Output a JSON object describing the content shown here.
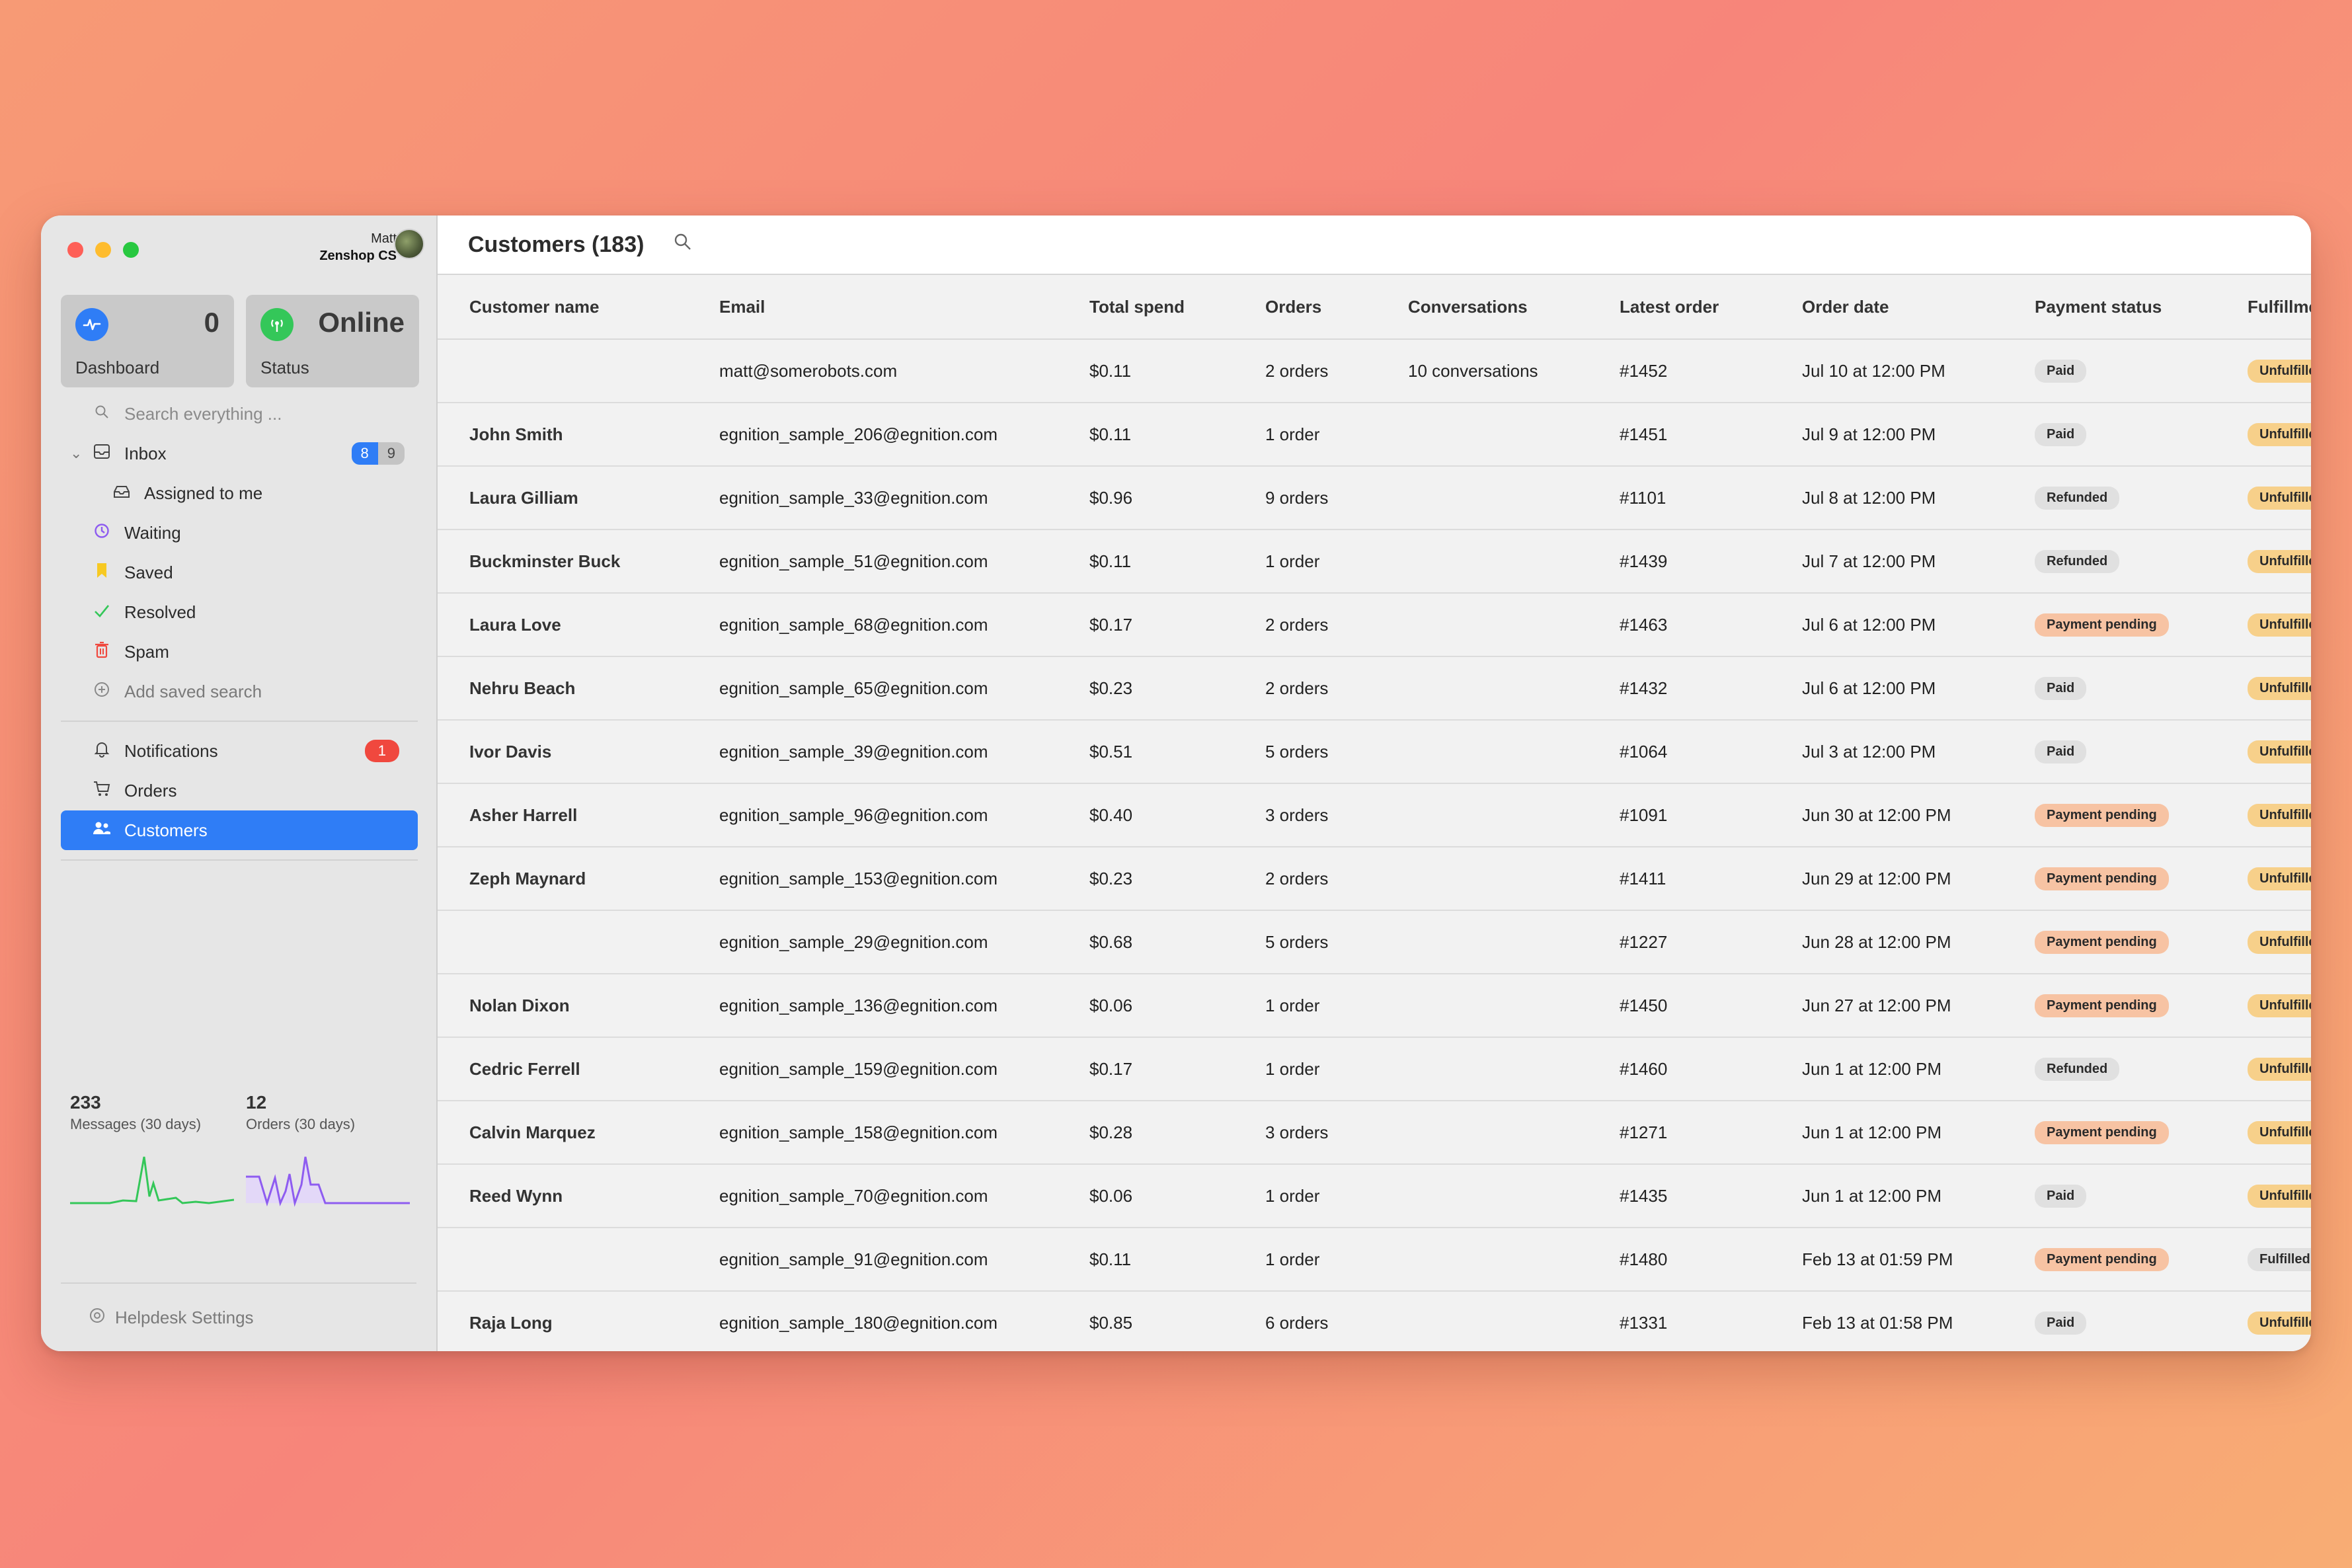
{
  "account": {
    "user": "Matt",
    "org": "Zenshop CS"
  },
  "tiles": [
    {
      "label": "Dashboard",
      "value": "0",
      "icon": "pulse-icon",
      "color": "#2f7df6"
    },
    {
      "label": "Status",
      "value": "Online",
      "icon": "broadcast-icon",
      "color": "#34c759"
    }
  ],
  "nav": {
    "search_placeholder": "Search everything ...",
    "inbox": {
      "label": "Inbox",
      "count_a": "8",
      "count_b": "9"
    },
    "assigned": "Assigned to me",
    "waiting": "Waiting",
    "saved": "Saved",
    "resolved": "Resolved",
    "spam": "Spam",
    "add_saved": "Add saved search",
    "notifications": {
      "label": "Notifications",
      "count": "1"
    },
    "orders": "Orders",
    "customers": "Customers",
    "settings": "Helpdesk Settings"
  },
  "stats": [
    {
      "value": "233",
      "label": "Messages (30 days)",
      "color": "#34c759"
    },
    {
      "value": "12",
      "label": "Orders (30 days)",
      "color": "#8e5cf0"
    }
  ],
  "header": {
    "title": "Customers (183)"
  },
  "columns": [
    "Customer name",
    "Email",
    "Total spend",
    "Orders",
    "Conversations",
    "Latest order",
    "Order date",
    "Payment status",
    "Fulfillment"
  ],
  "rows": [
    {
      "name": "",
      "email": "matt@somerobots.com",
      "spend": "$0.11",
      "orders": "2 orders",
      "conversations": "10 conversations",
      "latest": "#1452",
      "date": "Jul 10 at 12:00 PM",
      "payment": "Paid",
      "pay_class": "paid",
      "fulfillment": "Unfulfilled",
      "ful_class": "unfulfilled"
    },
    {
      "name": "John Smith",
      "email": "egnition_sample_206@egnition.com",
      "spend": "$0.11",
      "orders": "1 order",
      "conversations": "",
      "latest": "#1451",
      "date": "Jul 9 at 12:00 PM",
      "payment": "Paid",
      "pay_class": "paid",
      "fulfillment": "Unfulfilled",
      "ful_class": "unfulfilled"
    },
    {
      "name": "Laura Gilliam",
      "email": "egnition_sample_33@egnition.com",
      "spend": "$0.96",
      "orders": "9 orders",
      "conversations": "",
      "latest": "#1101",
      "date": "Jul 8 at 12:00 PM",
      "payment": "Refunded",
      "pay_class": "refunded",
      "fulfillment": "Unfulfilled",
      "ful_class": "unfulfilled"
    },
    {
      "name": "Buckminster Buck",
      "email": "egnition_sample_51@egnition.com",
      "spend": "$0.11",
      "orders": "1 order",
      "conversations": "",
      "latest": "#1439",
      "date": "Jul 7 at 12:00 PM",
      "payment": "Refunded",
      "pay_class": "refunded",
      "fulfillment": "Unfulfilled",
      "ful_class": "unfulfilled"
    },
    {
      "name": "Laura Love",
      "email": "egnition_sample_68@egnition.com",
      "spend": "$0.17",
      "orders": "2 orders",
      "conversations": "",
      "latest": "#1463",
      "date": "Jul 6 at 12:00 PM",
      "payment": "Payment pending",
      "pay_class": "pending",
      "fulfillment": "Unfulfilled",
      "ful_class": "unfulfilled"
    },
    {
      "name": "Nehru Beach",
      "email": "egnition_sample_65@egnition.com",
      "spend": "$0.23",
      "orders": "2 orders",
      "conversations": "",
      "latest": "#1432",
      "date": "Jul 6 at 12:00 PM",
      "payment": "Paid",
      "pay_class": "paid",
      "fulfillment": "Unfulfilled",
      "ful_class": "unfulfilled"
    },
    {
      "name": "Ivor Davis",
      "email": "egnition_sample_39@egnition.com",
      "spend": "$0.51",
      "orders": "5 orders",
      "conversations": "",
      "latest": "#1064",
      "date": "Jul 3 at 12:00 PM",
      "payment": "Paid",
      "pay_class": "paid",
      "fulfillment": "Unfulfilled",
      "ful_class": "unfulfilled"
    },
    {
      "name": "Asher Harrell",
      "email": "egnition_sample_96@egnition.com",
      "spend": "$0.40",
      "orders": "3 orders",
      "conversations": "",
      "latest": "#1091",
      "date": "Jun 30 at 12:00 PM",
      "payment": "Payment pending",
      "pay_class": "pending",
      "fulfillment": "Unfulfilled",
      "ful_class": "unfulfilled"
    },
    {
      "name": "Zeph Maynard",
      "email": "egnition_sample_153@egnition.com",
      "spend": "$0.23",
      "orders": "2 orders",
      "conversations": "",
      "latest": "#1411",
      "date": "Jun 29 at 12:00 PM",
      "payment": "Payment pending",
      "pay_class": "pending",
      "fulfillment": "Unfulfilled",
      "ful_class": "unfulfilled"
    },
    {
      "name": "",
      "email": "egnition_sample_29@egnition.com",
      "spend": "$0.68",
      "orders": "5 orders",
      "conversations": "",
      "latest": "#1227",
      "date": "Jun 28 at 12:00 PM",
      "payment": "Payment pending",
      "pay_class": "pending",
      "fulfillment": "Unfulfilled",
      "ful_class": "unfulfilled"
    },
    {
      "name": "Nolan Dixon",
      "email": "egnition_sample_136@egnition.com",
      "spend": "$0.06",
      "orders": "1 order",
      "conversations": "",
      "latest": "#1450",
      "date": "Jun 27 at 12:00 PM",
      "payment": "Payment pending",
      "pay_class": "pending",
      "fulfillment": "Unfulfilled",
      "ful_class": "unfulfilled"
    },
    {
      "name": "Cedric Ferrell",
      "email": "egnition_sample_159@egnition.com",
      "spend": "$0.17",
      "orders": "1 order",
      "conversations": "",
      "latest": "#1460",
      "date": "Jun 1 at 12:00 PM",
      "payment": "Refunded",
      "pay_class": "refunded",
      "fulfillment": "Unfulfilled",
      "ful_class": "unfulfilled"
    },
    {
      "name": "Calvin Marquez",
      "email": "egnition_sample_158@egnition.com",
      "spend": "$0.28",
      "orders": "3 orders",
      "conversations": "",
      "latest": "#1271",
      "date": "Jun 1 at 12:00 PM",
      "payment": "Payment pending",
      "pay_class": "pending",
      "fulfillment": "Unfulfilled",
      "ful_class": "unfulfilled"
    },
    {
      "name": "Reed Wynn",
      "email": "egnition_sample_70@egnition.com",
      "spend": "$0.06",
      "orders": "1 order",
      "conversations": "",
      "latest": "#1435",
      "date": "Jun 1 at 12:00 PM",
      "payment": "Paid",
      "pay_class": "paid",
      "fulfillment": "Unfulfilled",
      "ful_class": "unfulfilled"
    },
    {
      "name": "",
      "email": "egnition_sample_91@egnition.com",
      "spend": "$0.11",
      "orders": "1 order",
      "conversations": "",
      "latest": "#1480",
      "date": "Feb 13 at 01:59 PM",
      "payment": "Payment pending",
      "pay_class": "pending",
      "fulfillment": "Fulfilled",
      "ful_class": "fulfilled"
    },
    {
      "name": "Raja Long",
      "email": "egnition_sample_180@egnition.com",
      "spend": "$0.85",
      "orders": "6 orders",
      "conversations": "",
      "latest": "#1331",
      "date": "Feb 13 at 01:58 PM",
      "payment": "Paid",
      "pay_class": "paid",
      "fulfillment": "Unfulfilled",
      "ful_class": "unfulfilled"
    }
  ]
}
